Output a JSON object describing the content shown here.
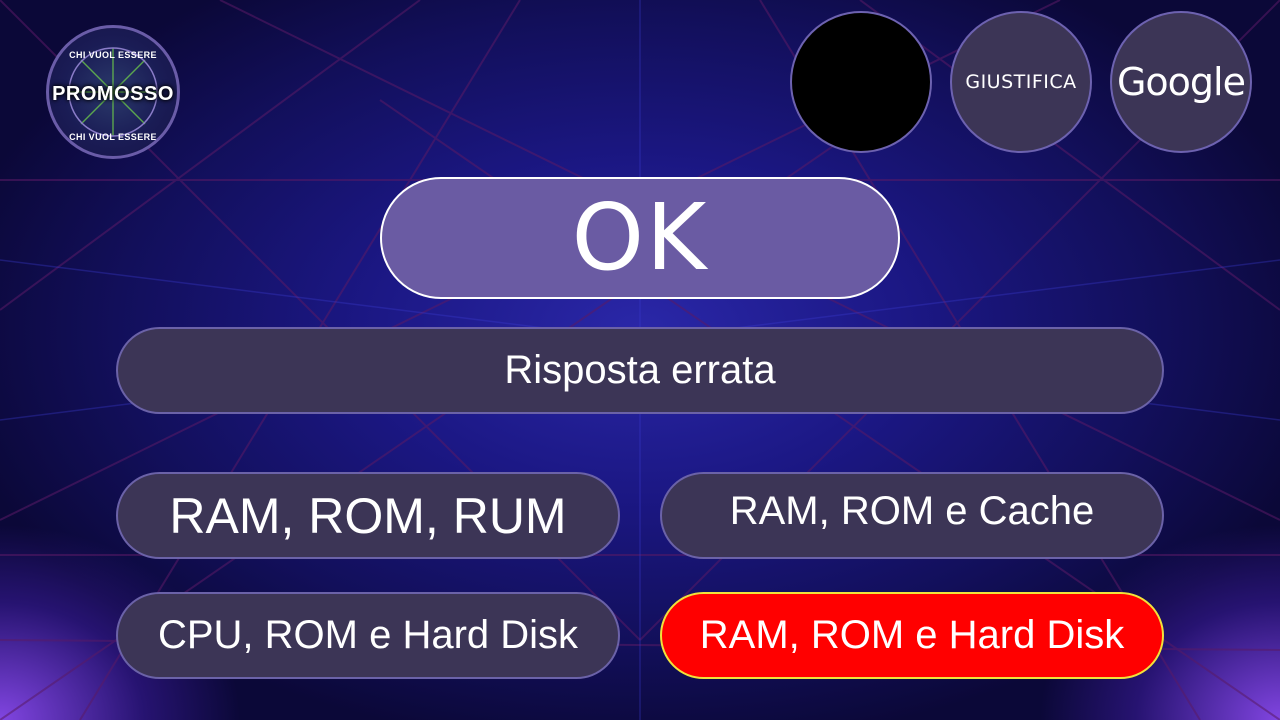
{
  "logo": {
    "arc_top": "CHI VUOL ESSERE",
    "title": "PROMOSSO",
    "arc_bottom": "CHI VUOL ESSERE"
  },
  "lifelines": {
    "blank_label": "",
    "justify_label": "GIUSTIFICA",
    "google_label": "Google"
  },
  "result": {
    "label": "OK"
  },
  "question": {
    "text": "Risposta errata"
  },
  "answers": [
    {
      "text": "RAM, ROM, RUM"
    },
    {
      "text": "RAM, ROM e Cache"
    },
    {
      "text": "CPU, ROM e Hard Disk"
    },
    {
      "text": "RAM, ROM e Hard Disk"
    }
  ],
  "colors": {
    "panel": "#3c3556",
    "panel_border": "#6b62a8",
    "ok_fill": "#6a5ba3",
    "highlight_fill": "#ff0000",
    "highlight_border": "#f2e23a"
  }
}
